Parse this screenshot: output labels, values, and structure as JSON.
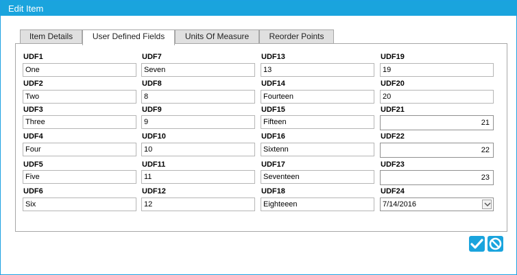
{
  "window": {
    "title": "Edit Item"
  },
  "tabs": [
    {
      "label": "Item Details"
    },
    {
      "label": "User Defined Fields"
    },
    {
      "label": "Units Of Measure"
    },
    {
      "label": "Reorder Points"
    }
  ],
  "fields": {
    "udf1": {
      "label": "UDF1",
      "value": "One"
    },
    "udf2": {
      "label": "UDF2",
      "value": "Two"
    },
    "udf3": {
      "label": "UDF3",
      "value": "Three"
    },
    "udf4": {
      "label": "UDF4",
      "value": "Four"
    },
    "udf5": {
      "label": "UDF5",
      "value": "Five"
    },
    "udf6": {
      "label": "UDF6",
      "value": "Six"
    },
    "udf7": {
      "label": "UDF7",
      "value": "Seven"
    },
    "udf8": {
      "label": "UDF8",
      "value": "8"
    },
    "udf9": {
      "label": "UDF9",
      "value": "9"
    },
    "udf10": {
      "label": "UDF10",
      "value": "10"
    },
    "udf11": {
      "label": "UDF11",
      "value": "11"
    },
    "udf12": {
      "label": "UDF12",
      "value": "12"
    },
    "udf13": {
      "label": "UDF13",
      "value": "13"
    },
    "udf14": {
      "label": "UDF14",
      "value": "Fourteen"
    },
    "udf15": {
      "label": "UDF15",
      "value": "Fifteen"
    },
    "udf16": {
      "label": "UDF16",
      "value": "Sixtenn"
    },
    "udf17": {
      "label": "UDF17",
      "value": "Seventeen"
    },
    "udf18": {
      "label": "UDF18",
      "value": "Eighteeen"
    },
    "udf19": {
      "label": "UDF19",
      "value": "19"
    },
    "udf20": {
      "label": "UDF20",
      "value": "20"
    },
    "udf21": {
      "label": "UDF21",
      "value": "21"
    },
    "udf22": {
      "label": "UDF22",
      "value": "22"
    },
    "udf23": {
      "label": "UDF23",
      "value": "23"
    },
    "udf24": {
      "label": "UDF24",
      "value": "7/14/2016"
    }
  },
  "actions": {
    "save_icon": "checkmark-icon",
    "cancel_icon": "cancel-icon"
  },
  "colors": {
    "accent": "#1aa4dd"
  }
}
